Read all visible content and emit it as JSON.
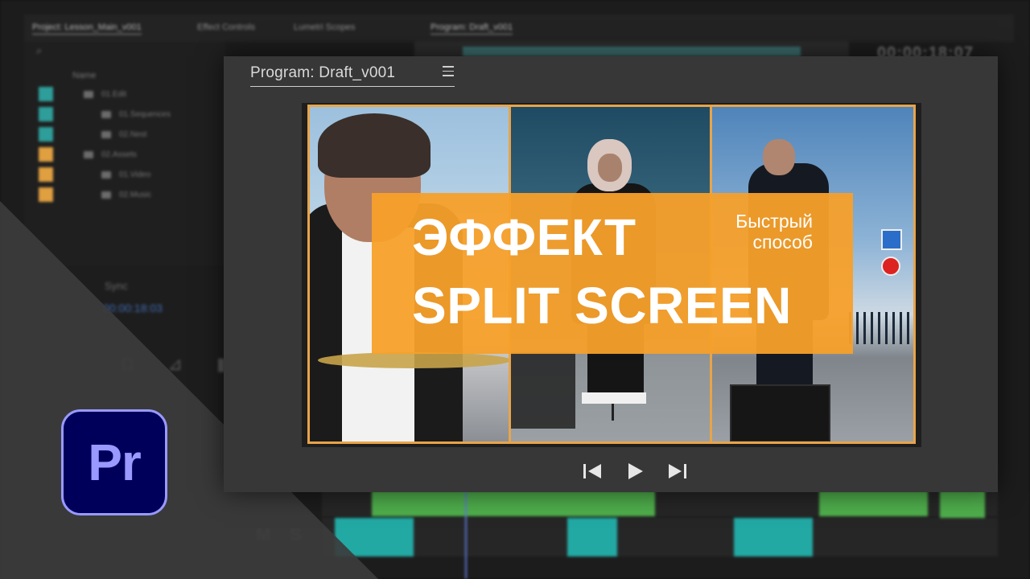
{
  "background_editor": {
    "tabs": [
      "Project: Lesson_Main_v001",
      "Effect Controls",
      "Lumetri Scopes",
      "Program: Draft_v001"
    ],
    "timecode_right": "00:00:18:07",
    "timecode_left": "00:00:18:03",
    "sync_label": "Sync",
    "search_glyph": "⌕",
    "column_header": "Name",
    "project_rows": [
      {
        "label": "01.Edit",
        "color": "#2e9e9a"
      },
      {
        "label": "01.Sequences",
        "color": "#2e9e9a"
      },
      {
        "label": "02.Nest",
        "color": "#2e9e9a"
      },
      {
        "label": "02.Assets",
        "color": "#e0a040"
      },
      {
        "label": "01.Video",
        "color": "#e0a040"
      },
      {
        "label": "02.Music",
        "color": "#e0a040"
      }
    ],
    "track_buttons": [
      "M",
      "S"
    ],
    "track_glyphs": "Ω ⊿ ▮"
  },
  "program_monitor": {
    "title": "Program: Draft_v001",
    "menu_icon": "hamburger-menu-icon"
  },
  "thumbnail": {
    "headline_line1": "ЭФФЕКТ",
    "headline_line2": "SPLIT SCREEN",
    "subtitle_line1": "Быстрый",
    "subtitle_line2": "способ",
    "accent_color": "#f7a02a"
  },
  "transport": {
    "controls": [
      "step-back-icon",
      "play-icon",
      "step-forward-icon"
    ]
  },
  "app_logo": {
    "text": "Pr",
    "bg_color": "#00005b",
    "fg_color": "#9999ff"
  }
}
